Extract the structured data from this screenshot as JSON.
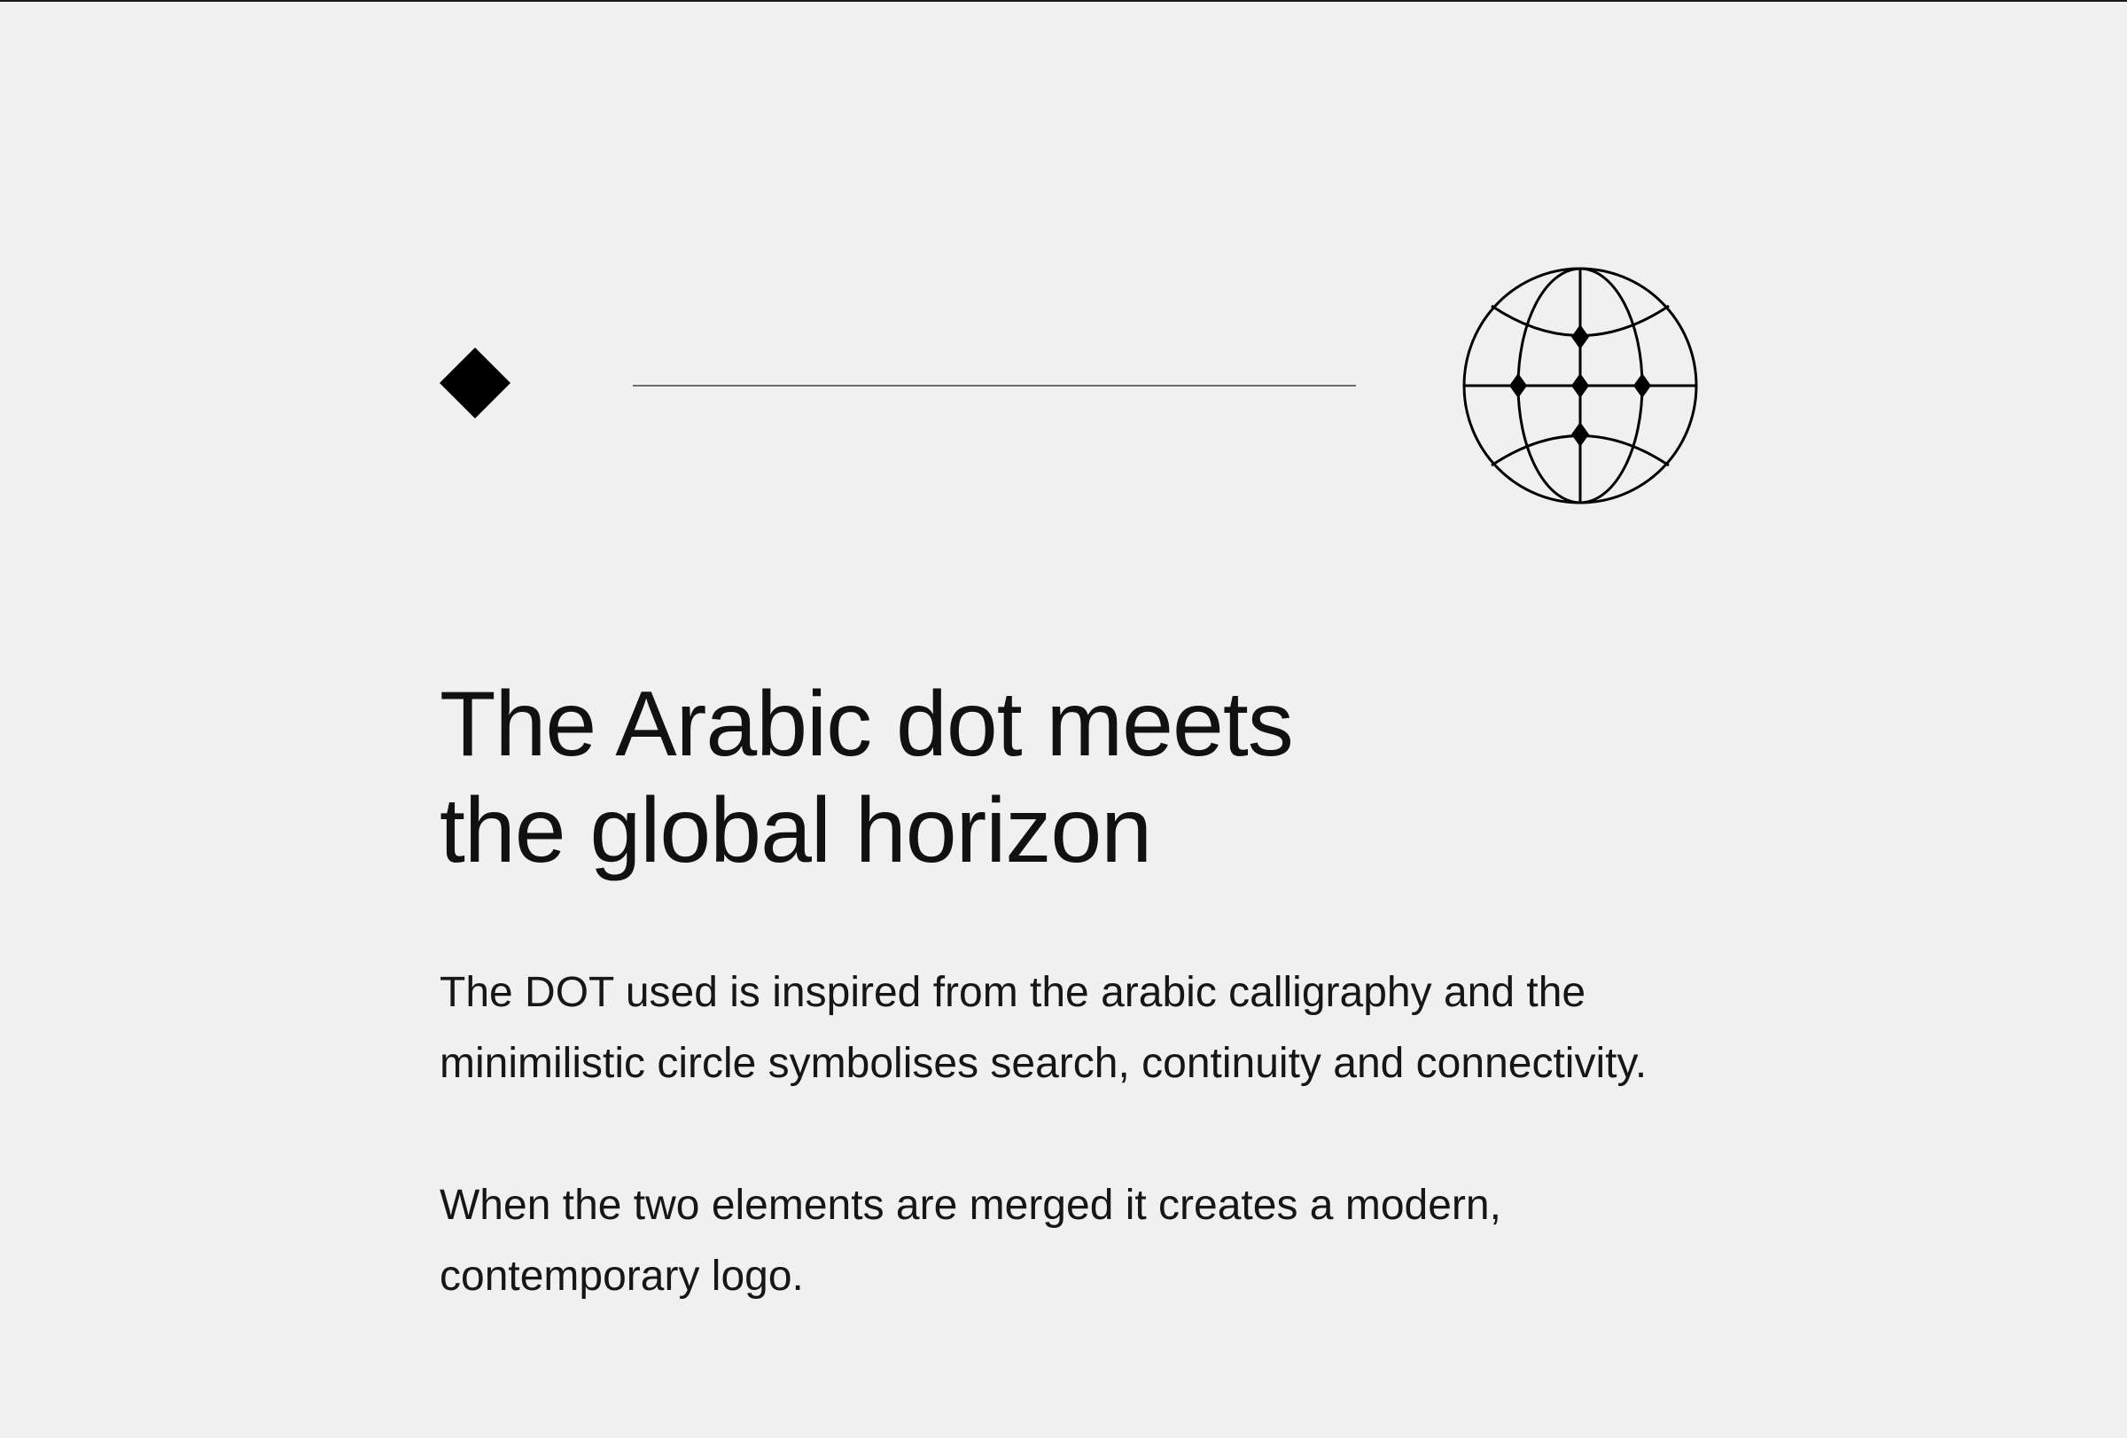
{
  "headline": {
    "line1": "The Arabic dot meets",
    "line2": "the global horizon"
  },
  "body": {
    "paragraph1": {
      "line1": "The DOT used is inspired from the arabic calligraphy and the",
      "line2": "minimilistic circle symbolises search, continuity and connectivity."
    },
    "paragraph2": {
      "line1": "When the two elements are merged it creates a modern,",
      "line2": "contemporary logo."
    }
  },
  "icons": {
    "dot": "diamond-dot-icon",
    "globe": "globe-with-dots-icon"
  },
  "colors": {
    "background": "#f0f0f0",
    "ink": "#111111",
    "connector": "#6d6d6d"
  }
}
